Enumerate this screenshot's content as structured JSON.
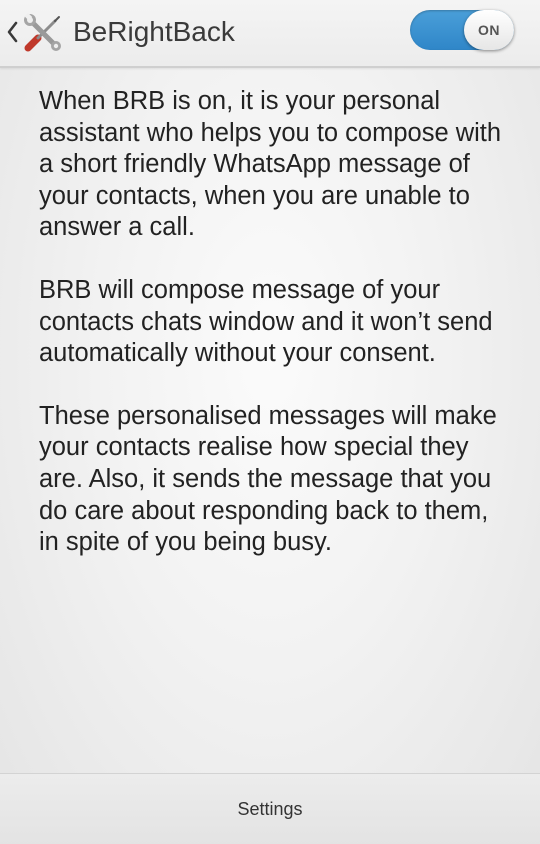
{
  "action_bar": {
    "back_icon": "chevron-left-icon",
    "app_icon": "tools-wrench-screwdriver-icon",
    "title": "BeRightBack",
    "toggle": {
      "state_label": "ON",
      "is_on": true,
      "track_color": "#3b8fcf"
    }
  },
  "content": {
    "paragraphs": [
      "When BRB is on, it is your personal assistant who helps you to compose with a short friendly WhatsApp message of your contacts, when you are unable to answer a call.",
      "BRB will compose message of your contacts chats window and it won’t send automatically without your consent.",
      "These personalised messages will make your contacts realise how special they are. Also, it sends the message that you do care about responding back to them, in spite of you being busy."
    ]
  },
  "bottom_bar": {
    "settings_label": "Settings"
  }
}
